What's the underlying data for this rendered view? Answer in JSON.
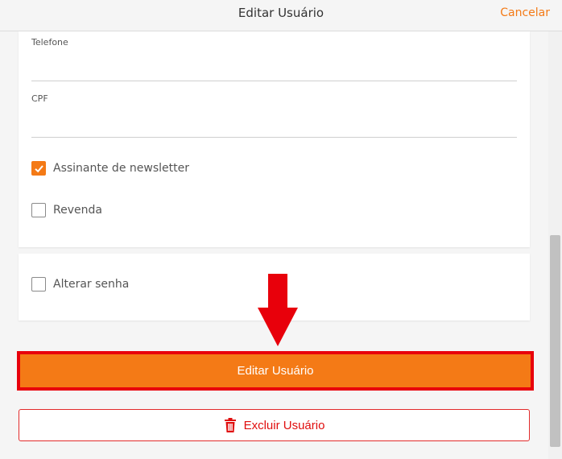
{
  "header": {
    "title": "Editar Usuário",
    "cancel_label": "Cancelar"
  },
  "form": {
    "phone": {
      "label": "Telefone",
      "value": ""
    },
    "cpf": {
      "label": "CPF",
      "value": ""
    },
    "newsletter": {
      "label": "Assinante de newsletter",
      "checked": true
    },
    "reseller": {
      "label": "Revenda",
      "checked": false
    },
    "change_password": {
      "label": "Alterar senha",
      "checked": false
    }
  },
  "actions": {
    "edit_label": "Editar Usuário",
    "delete_label": "Excluir Usuário"
  },
  "colors": {
    "accent": "#f47a16",
    "danger": "#e00d0d",
    "annotation": "#e8000b"
  },
  "icons": {
    "checkmark": "check-icon",
    "trash": "trash-icon",
    "annotation_arrow": "arrow-down-icon"
  }
}
